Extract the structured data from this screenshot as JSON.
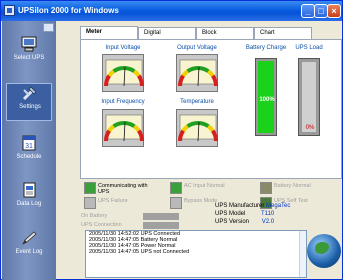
{
  "window": {
    "title": "UPSilon 2000 for Windows"
  },
  "sidebar": {
    "items": [
      {
        "label": "Select UPS",
        "icon": "computer-icon"
      },
      {
        "label": "Settings",
        "icon": "settings-icon"
      },
      {
        "label": "Schedule",
        "icon": "calendar-icon"
      },
      {
        "label": "Data Log",
        "icon": "document-icon"
      },
      {
        "label": "Event Log",
        "icon": "pen-icon"
      }
    ],
    "active": "Settings"
  },
  "tabs": [
    {
      "label": "Meter",
      "active": true
    },
    {
      "label": "Digital"
    },
    {
      "label": "Block"
    },
    {
      "label": "Chart"
    }
  ],
  "meters": {
    "input_voltage": {
      "label": "Input Voltage"
    },
    "output_voltage": {
      "label": "Output Voltage"
    },
    "input_frequency": {
      "label": "Input Frequency"
    },
    "temperature": {
      "label": "Temperature"
    },
    "battery_charge": {
      "label": "Battery Charge",
      "value": "100%",
      "level": 1.0
    },
    "ups_load": {
      "label": "UPS Load",
      "value": "0%",
      "level": 0.0
    }
  },
  "status": {
    "communicating": "Communicating with UPS",
    "ac_input_normal": "AC Input Normal",
    "battery_normal": "Battery Normal",
    "ups_failure": "UPS Failure",
    "bypass_mode": "Bypass Mode",
    "ups_self_test": "UPS Self Test",
    "on_battery": "On Battery",
    "ups_connection": "UPS Connection"
  },
  "info": {
    "manufacturer_label": "UPS Manufacturer",
    "manufacturer_value": "MegaTec",
    "model_label": "UPS Model",
    "model_value": "T110",
    "version_label": "UPS Version",
    "version_value": "V2.0"
  },
  "log": [
    "2005/11/30 14:52:02 UPS Connected",
    "2005/11/30 14:47:05 Battery Normal",
    "2005/11/30 14:47:05 Power Normal",
    "2005/11/30 14:47:05 UPS not Connected"
  ],
  "colors": {
    "titlebar": "#0653d6",
    "accent_label": "#0a4fa8",
    "charge_fill": "#1ad21a",
    "value_text": "#0033cc"
  }
}
